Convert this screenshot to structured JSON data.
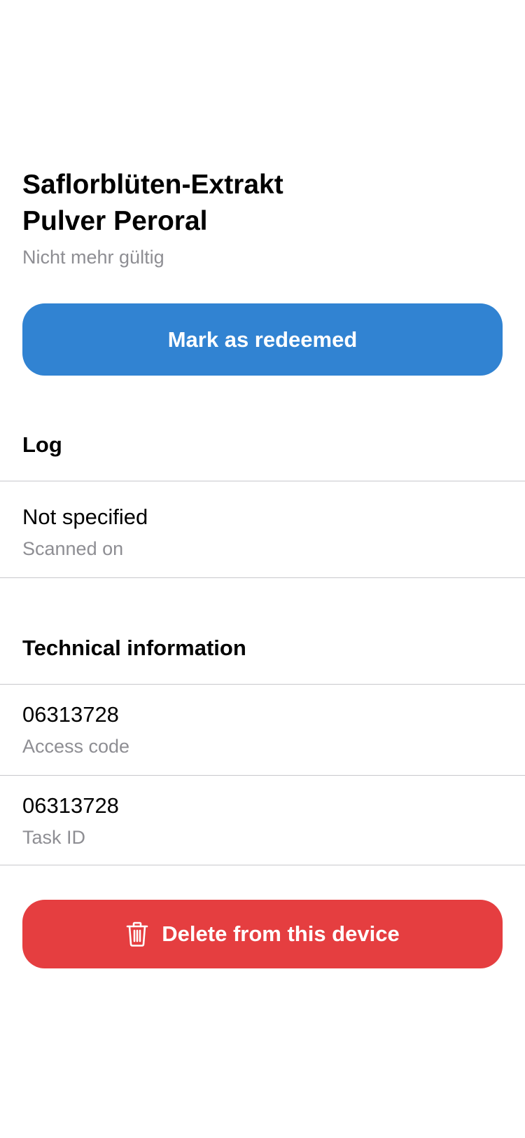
{
  "header": {
    "title": "Saflorblüten-Extrakt Pulver Peroral",
    "subtitle": "Nicht mehr gültig"
  },
  "actions": {
    "redeem_label": "Mark as redeemed",
    "delete_label": "Delete from this device"
  },
  "log": {
    "heading": "Log",
    "items": [
      {
        "value": "Not specified",
        "label": "Scanned on"
      }
    ]
  },
  "technical": {
    "heading": "Technical information",
    "items": [
      {
        "value": "06313728",
        "label": "Access code"
      },
      {
        "value": "06313728",
        "label": "Task ID"
      }
    ]
  },
  "colors": {
    "primary": "#3183d2",
    "danger": "#e53e40",
    "secondary_text": "#8e8e93",
    "divider": "#c8c8cc"
  },
  "icons": {
    "delete": "trash-icon"
  }
}
